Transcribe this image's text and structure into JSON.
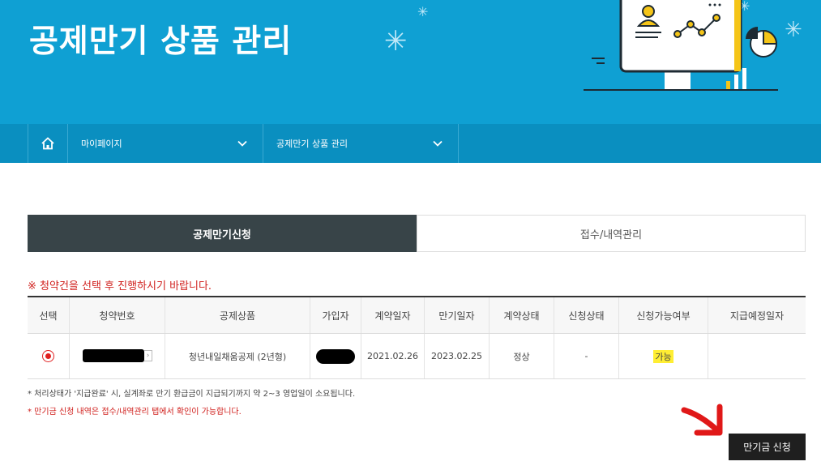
{
  "banner": {
    "title": "공제만기 상품 관리"
  },
  "nav": {
    "home_icon": "home-icon",
    "dropdown1_label": "마이페이지",
    "dropdown2_label": "공제만기 상품 관리"
  },
  "tabs": [
    {
      "label": "공제만기신청",
      "active": true
    },
    {
      "label": "접수/내역관리",
      "active": false
    }
  ],
  "notice": "※ 청약건을 선택 후 진행하시기 바랍니다.",
  "table": {
    "headers": [
      "선택",
      "청약번호",
      "공제상품",
      "가입자",
      "계약일자",
      "만기일자",
      "계약상태",
      "신청상태",
      "신청가능여부",
      "지급예정일자"
    ],
    "rows": [
      {
        "selected": true,
        "product": "청년내일채움공제 (2년형)",
        "contract_date": "2021.02.26",
        "maturity_date": "2023.02.25",
        "contract_status": "정상",
        "apply_status": "-",
        "eligibility": "가능",
        "payment_date": ""
      }
    ]
  },
  "footnotes": [
    "* 처리상태가 '지급완료' 시, 실계좌로 만기 환급금이 지급되기까지 약 2~3 영업일이 소요됩니다.",
    "* 만기금 신청 내역은 접수/내역관리 탭에서 확인이 가능합니다."
  ],
  "apply_button": "만기금 신청",
  "colors": {
    "banner": "#0fa0d3",
    "navbar": "#0a8fc0",
    "active_tab": "#384448",
    "notice_red": "#d0201d",
    "highlight": "#ffee33"
  }
}
